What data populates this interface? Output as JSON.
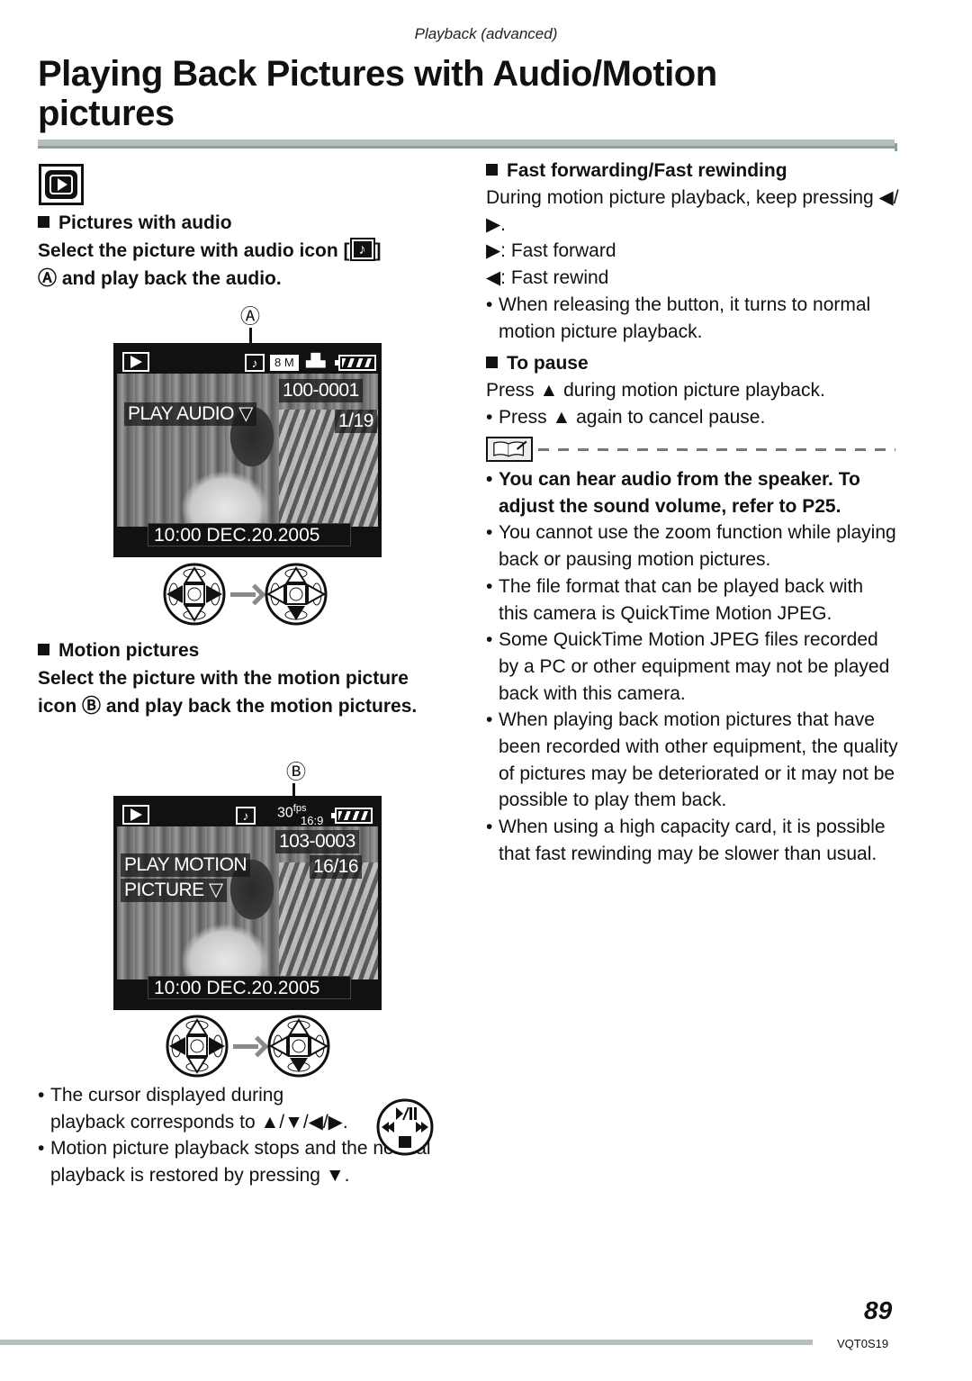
{
  "header": {
    "running_head": "Playback (advanced)",
    "title": "Playing Back Pictures with Audio/Motion pictures",
    "mode_icon": "playback-mode-icon"
  },
  "left": {
    "audio_section": {
      "heading": "Pictures with audio",
      "instruction_part1": "Select the picture with audio icon [",
      "instruction_icon": "♪",
      "instruction_part2": "]",
      "instruction_line2": "Ⓐ and play back the audio.",
      "callout": "Ⓐ",
      "screen": {
        "badge_size": "8 M",
        "file_number": "100-0001",
        "label": "PLAY AUDIO ▽",
        "counter": "1/19",
        "datetime": "10:00  DEC.20.2005",
        "audio_icon": "♪",
        "quality_icon": "▟▙"
      },
      "dpad_from": "left-right-active",
      "dpad_to": "down-active"
    },
    "motion_section": {
      "heading": "Motion pictures",
      "instruction": "Select the picture with the motion picture icon Ⓑ and play back the motion pictures.",
      "callout": "Ⓑ",
      "screen": {
        "fps_value": "30",
        "fps_unit": "fps",
        "aspect": "16:9",
        "file_number": "103-0003",
        "label_line1": "PLAY MOTION",
        "label_line2": "PICTURE ▽",
        "counter": "16/16",
        "datetime": "10:00  DEC.20.2005",
        "audio_icon": "♪"
      }
    },
    "notes": [
      "The cursor displayed during playback corresponds to ▲/▼/◀/▶.",
      "Motion picture playback stops and the normal playback is restored by pressing ▼."
    ],
    "control_icon": {
      "top": "▶/II",
      "left": "◀◀",
      "right": "▶▶",
      "bottom": "■"
    }
  },
  "right": {
    "ff_section": {
      "heading": "Fast forwarding/Fast rewinding",
      "text": "During motion picture playback, keep pressing ◀/▶.",
      "ff": "▶: Fast forward",
      "rw": "◀: Fast rewind",
      "bullet": "When releasing the button, it turns to normal motion picture playback."
    },
    "pause_section": {
      "heading": "To pause",
      "text": "Press ▲ during motion picture playback.",
      "bullet": "Press ▲ again to cancel pause."
    },
    "notes": {
      "bold_note": "You can hear audio from the speaker. To adjust the sound volume, refer to P25.",
      "items": [
        "You cannot use the zoom function while playing back or pausing motion pictures.",
        "The file format that can be played back with this camera is QuickTime Motion JPEG.",
        "Some QuickTime Motion JPEG files recorded by a PC or other equipment may not be played back with this camera.",
        "When playing back motion pictures that have been recorded with other equipment, the quality of pictures may be deteriorated or it may not be possible to play them back.",
        "When using a high capacity card, it is possible that fast rewinding may be slower than usual."
      ]
    }
  },
  "footer": {
    "page_number": "89",
    "doc_code": "VQT0S19"
  }
}
